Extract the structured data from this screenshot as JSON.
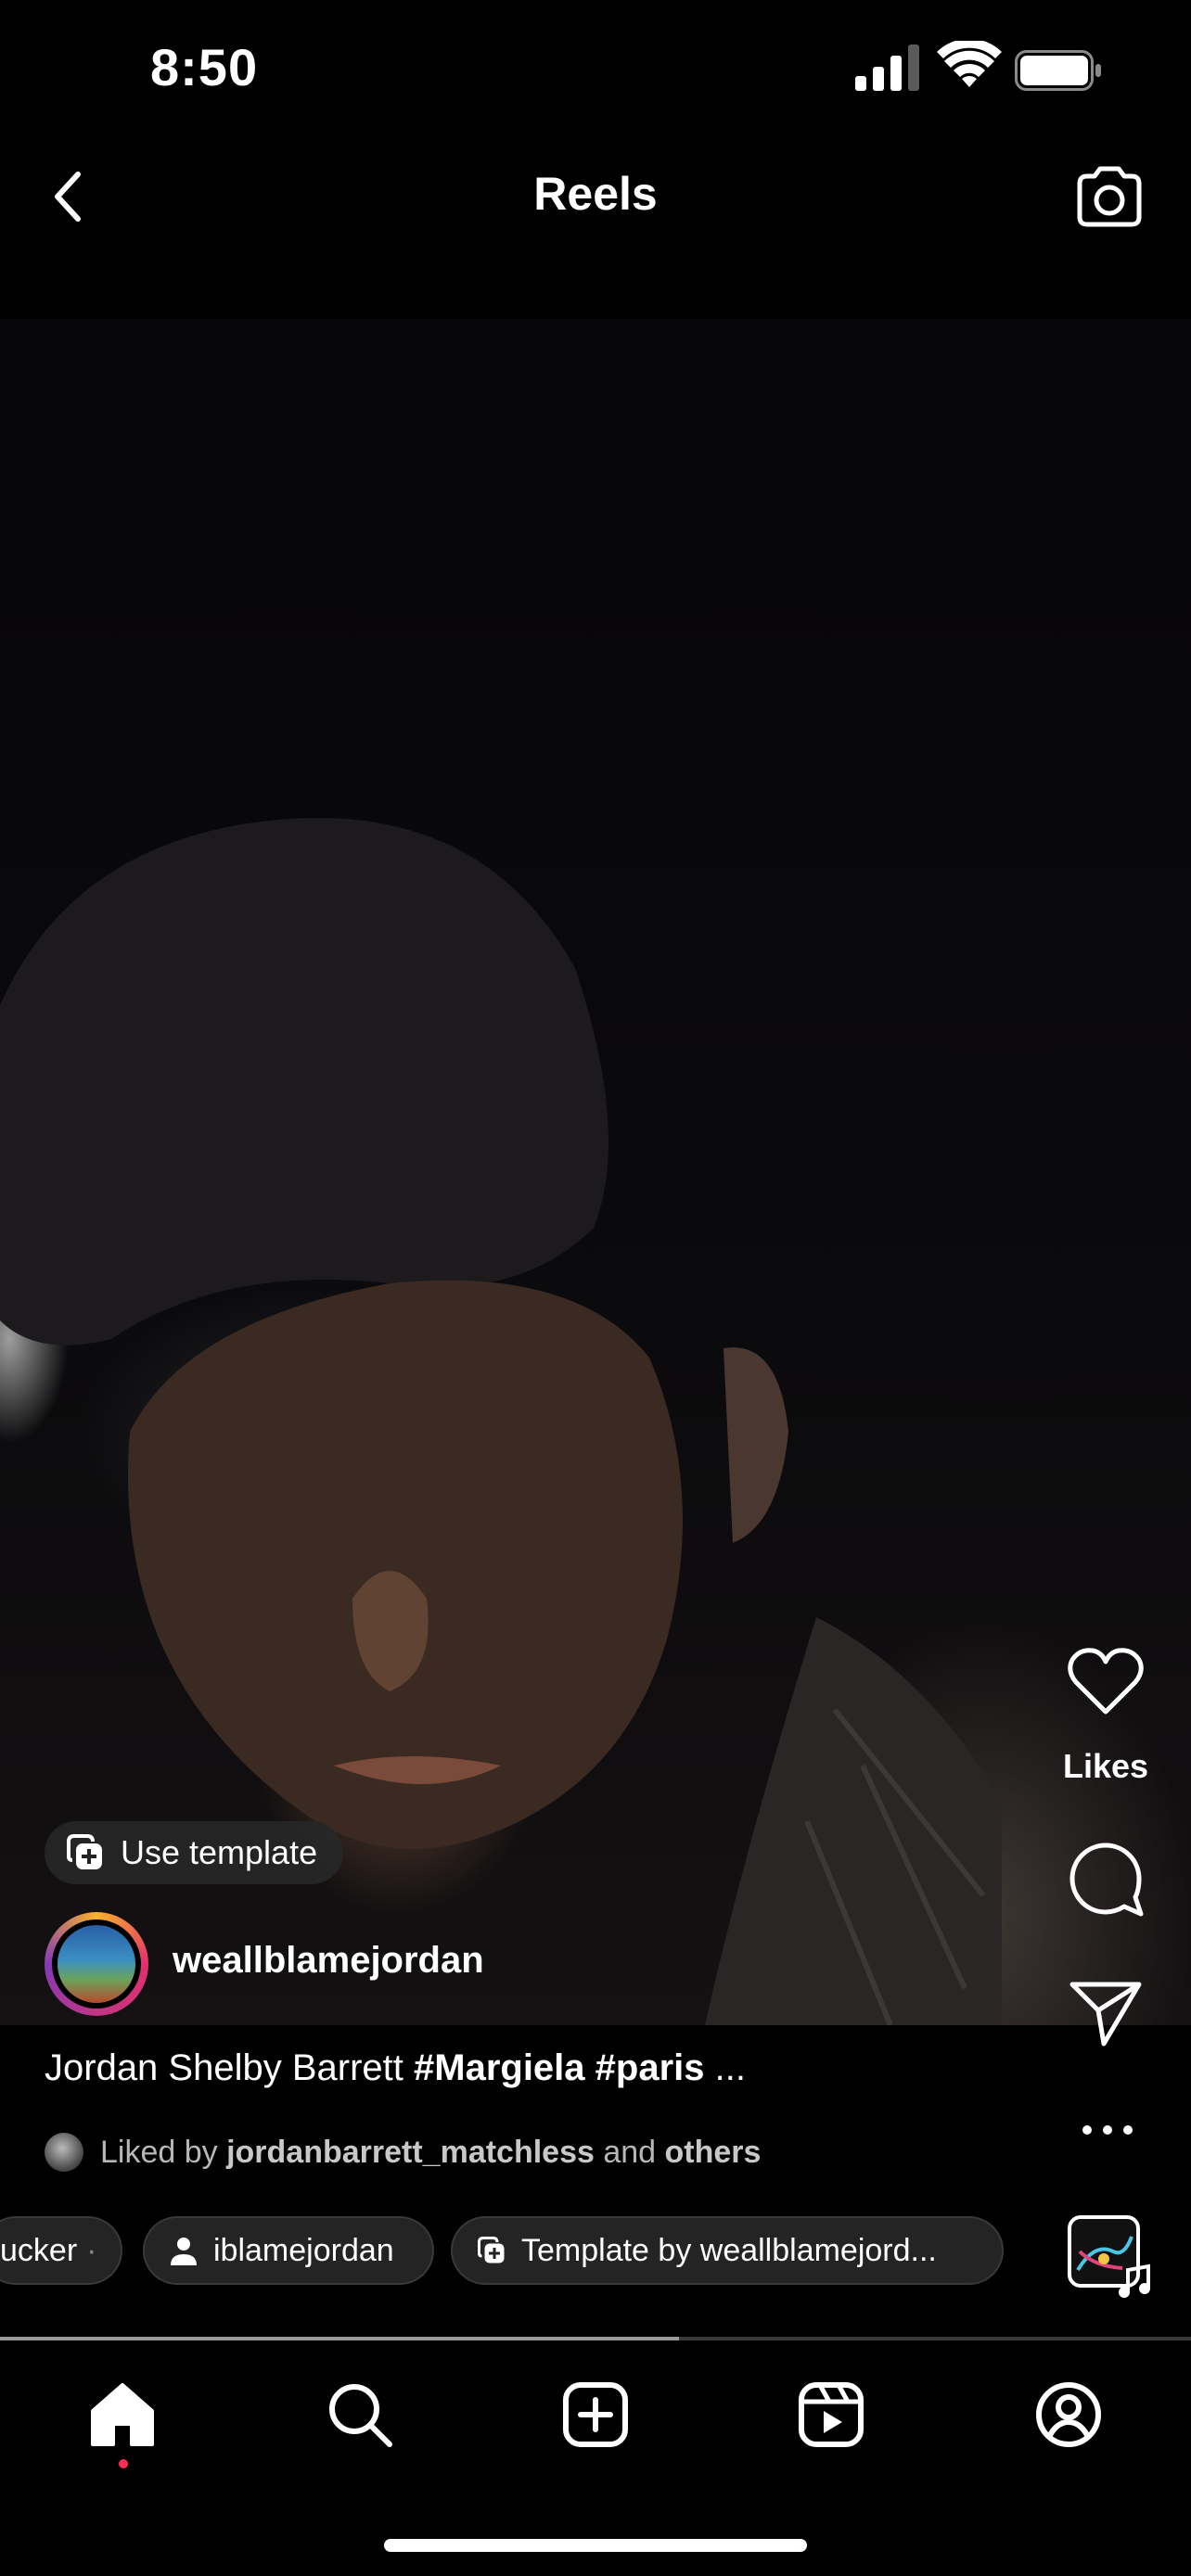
{
  "status_bar": {
    "time": "8:50"
  },
  "header": {
    "title": "Reels"
  },
  "actions": {
    "likes_label": "Likes"
  },
  "post": {
    "use_template_label": "Use template",
    "username": "weallblamejordan",
    "caption_text": "Jordan Shelby Barrett ",
    "caption_tags": "#Margiela #paris",
    "caption_more": " ...",
    "liked_by_prefix": "Liked by ",
    "liked_by_user": "jordanbarrett_matchless",
    "liked_by_and": " and ",
    "liked_by_others": "others"
  },
  "chips": [
    {
      "label": "ucker"
    },
    {
      "label": "iblamejordan"
    },
    {
      "label": "Template by weallblamejord..."
    }
  ],
  "playback": {
    "progress": 0.57
  },
  "colors": {
    "background": "#000000",
    "notification_dot": "#ff2d55",
    "chip_bg": "#262626"
  }
}
